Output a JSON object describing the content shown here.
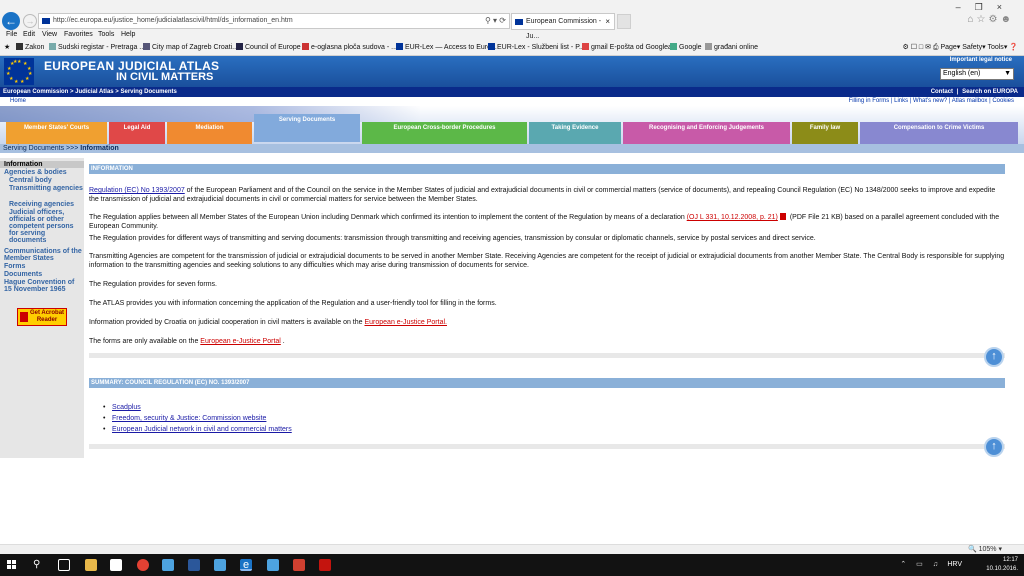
{
  "browser": {
    "url": "http://ec.europa.eu/justice_home/judicialatlascivil/html/ds_information_en.htm",
    "tab_title": "European Commission - Ju...",
    "menu": [
      "File",
      "Edit",
      "View",
      "Favorites",
      "Tools",
      "Help"
    ],
    "favorites": [
      "Zakon",
      "Sudski registar - Pretraga ...",
      "City map of Zagreb Croati...",
      "Council of Europe",
      "e-oglasna ploča sudova - ...",
      "EUR-Lex — Access to Euro...",
      "EUR-Lex - Službeni list - P...",
      "gmail E-pošta od Googlea",
      "Google",
      "građani online"
    ],
    "command_bar": [
      "Page",
      "Safety",
      "Tools"
    ],
    "zoom": "105%"
  },
  "header": {
    "title_line1": "EUROPEAN JUDICIAL ATLAS",
    "title_line2": "IN CIVIL MATTERS",
    "legal_notice": "Important legal notice",
    "language": "English (en)"
  },
  "breadcrumb": {
    "path": "European Commission > Judicial Atlas > Serving Documents",
    "contact": "Contact",
    "sep": "|",
    "search": "Search on EUROPA"
  },
  "subnav": {
    "home": "Home",
    "links": "Filling in Forms | Links | What's new? | Atlas mailbox | Cookies"
  },
  "tabs": [
    {
      "label": "Member States' Courts",
      "color": "#f0a030"
    },
    {
      "label": "Legal Aid",
      "color": "#e04848"
    },
    {
      "label": "Mediation",
      "color": "#f08a30"
    },
    {
      "label": "Serving Documents",
      "color": "#82aadc"
    },
    {
      "label": "European Cross-border Procedures",
      "color": "#5cb848"
    },
    {
      "label": "Taking Evidence",
      "color": "#5aa8b0"
    },
    {
      "label": "Recognising and Enforcing Judgements",
      "color": "#c85aa8"
    },
    {
      "label": "Family law",
      "color": "#8c8c18"
    },
    {
      "label": "Compensation to Crime Victims",
      "color": "#8888d0"
    }
  ],
  "crumb_row": {
    "section": "Serving Documents >>> ",
    "current": "Information"
  },
  "sidebar": {
    "heading": "Information",
    "items": [
      {
        "label": "Agencies & bodies",
        "level": "top"
      },
      {
        "label": "Central body",
        "level": "sub"
      },
      {
        "label": "Transmitting agencies",
        "level": "sub"
      },
      {
        "label": "Receiving agencies",
        "level": "sub"
      },
      {
        "label": "Judicial officers, officials or other competent persons for serving documents",
        "level": "sub"
      },
      {
        "label": "Communications of the Member States",
        "level": "top"
      },
      {
        "label": "Forms",
        "level": "top"
      },
      {
        "label": "Documents",
        "level": "top"
      },
      {
        "label": "Hague Convention of 15 November 1965",
        "level": "top"
      }
    ],
    "acrobat": "Get Acrobat Reader"
  },
  "content": {
    "info_heading": "INFORMATION",
    "p1_link": "Regulation (EC) No 1393/2007",
    "p1_text": " of the European Parliament and of the Council on the service in the Member States of judicial and extrajudicial documents in civil or commercial matters (service of documents), and repealing Council Regulation (EC) No 1348/2000 seeks to improve and expedite the transmission of judicial and extrajudicial documents in civil or commercial matters for service between the Member States.",
    "p2_text_a": "The Regulation applies between all Member States of the European Union including Denmark which confirmed its intention to implement the content of the Regulation by means of a declaration ",
    "p2_link": "(OJ L 331, 10.12.2008, p. 21)",
    "p2_text_b": " (PDF File 21 KB) based on a parallel agreement concluded with the European Community.",
    "p3_text": "The Regulation provides for different ways of transmitting and serving documents: transmission through transmitting and receiving agencies, transmission by consular or diplomatic channels, service by postal services and direct service.",
    "p4_text": "Transmitting Agencies are competent for the transmission of judicial or extrajudicial documents to be served in another Member State. Receiving Agencies are competent for the receipt of judicial or extrajudicial documents from another Member State. The Central Body is responsible for supplying information to the transmitting agencies and seeking solutions to any difficulties which may arise during transmission of documents for service.",
    "p5_text": "The Regulation provides for seven forms.",
    "p6_text": "The ATLAS provides you with information concerning the application of the Regulation and a user-friendly tool for filling in the forms.",
    "p7_text": "Information provided by Croatia on judicial cooperation in civil matters is available on the ",
    "p7_link": "European e-Justice Portal.",
    "p8_text": "The forms are only available on the ",
    "p8_link": "European e-Justice Portal",
    "p8_end": " .",
    "summary_heading": "SUMMARY: COUNCIL REGULATION (EC) NO. 1393/2007",
    "summary_links": [
      "Scadplus",
      "Freedom, security & Justice: Commission website",
      "European Judicial network in civil and commercial matters"
    ]
  },
  "taskbar": {
    "lang": "HRV",
    "time": "12:17",
    "date": "10.10.2016."
  },
  "colors": {
    "header_blue": "#1a4f9c",
    "breadcrumb_navy": "#0a2a8a",
    "section_blue": "#8ab0d8",
    "link_red": "#cc0000",
    "link_blue": "#1a1aa6"
  }
}
